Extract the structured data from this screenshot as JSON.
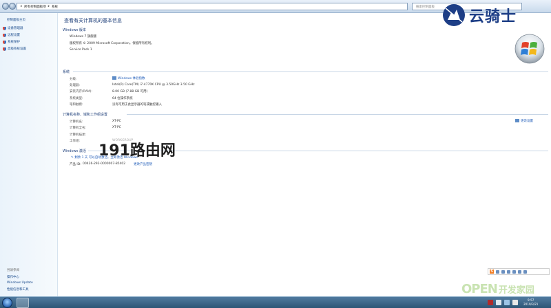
{
  "address_bar": {
    "crumb1": "所有控制面板项",
    "crumb2": "系统",
    "search_placeholder": "搜索控制面板"
  },
  "sidebar": {
    "home": "控制面板主页",
    "items": [
      {
        "label": "设备管理器"
      },
      {
        "label": "远程设置"
      },
      {
        "label": "系统保护"
      },
      {
        "label": "高级系统设置"
      }
    ],
    "see_also": "另请参阅",
    "bottom_links": [
      {
        "label": "操作中心"
      },
      {
        "label": "Windows Update"
      },
      {
        "label": "性能信息和工具"
      }
    ]
  },
  "main": {
    "title": "查看有关计算机的基本信息",
    "edition": {
      "header": "Windows 版本",
      "name": "Windows 7 旗舰版",
      "copyright": "版权所有 © 2009 Microsoft Corporation。保留所有权利。",
      "service_pack": "Service Pack 1"
    },
    "system": {
      "header": "系统",
      "rows": [
        {
          "label": "分级:",
          "value": "Windows 体验指数"
        },
        {
          "label": "处理器:",
          "value": "Intel(R) Core(TM) i7-4770K CPU @ 3.50GHz   3.50 GHz"
        },
        {
          "label": "安装内存(RAM):",
          "value": "8.00 GB (7.88 GB 可用)"
        },
        {
          "label": "系统类型:",
          "value": "64 位操作系统"
        },
        {
          "label": "笔和触摸:",
          "value": "没有可用于此显示器的笔或触控输入"
        }
      ]
    },
    "computer": {
      "header": "计算机名称、域和工作组设置",
      "change_settings": "更改设置",
      "rows": [
        {
          "label": "计算机名:",
          "value": "XT-PC"
        },
        {
          "label": "计算机全名:",
          "value": "XT-PC"
        },
        {
          "label": "计算机描述:",
          "value": ""
        },
        {
          "label": "工作组:",
          "value": "WORKGROUP"
        }
      ]
    },
    "activation": {
      "header": "Windows 激活",
      "remaining": "剩余 1 天 可以自动激活。立即激活 Windows",
      "product_id_label": "产品 ID:",
      "product_id": "00426-292-0000007-85402",
      "change_key": "更改产品密钥"
    }
  },
  "watermarks": {
    "brand": "云骑士",
    "center": "191路由网",
    "open": "OPEN",
    "open_suffix": "开发家园"
  },
  "taskbar": {
    "time": "9:57",
    "date": "2019/3/21"
  },
  "colors": {
    "link": "#1e5bb8",
    "heading": "#1e3f7a",
    "taskbar": "#2d5676",
    "brand": "#1d3e86"
  }
}
